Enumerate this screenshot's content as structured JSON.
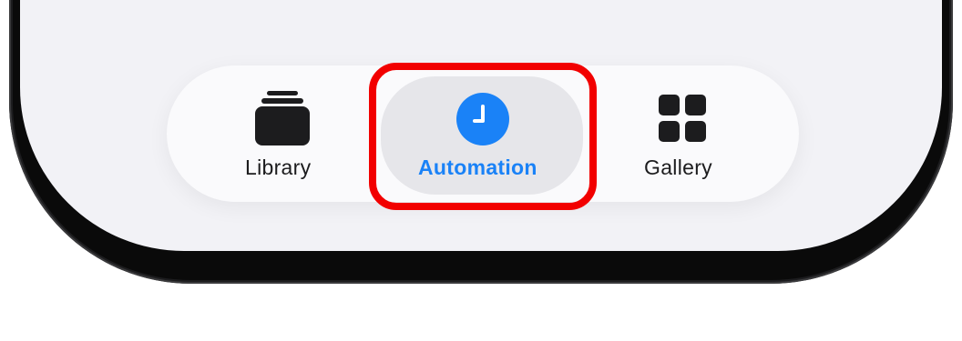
{
  "tab_bar": {
    "tabs": [
      {
        "label": "Library",
        "icon": "library-stack-icon",
        "selected": false
      },
      {
        "label": "Automation",
        "icon": "clock-icon",
        "selected": true
      },
      {
        "label": "Gallery",
        "icon": "grid-icon",
        "selected": false
      }
    ]
  },
  "colors": {
    "accent": "#1a82f7",
    "highlight": "#f20000",
    "icon_dark": "#1c1c1e",
    "screen_bg": "#f2f2f6",
    "tab_bar_bg": "#fafafc",
    "selected_bg": "#e6e6ea"
  }
}
